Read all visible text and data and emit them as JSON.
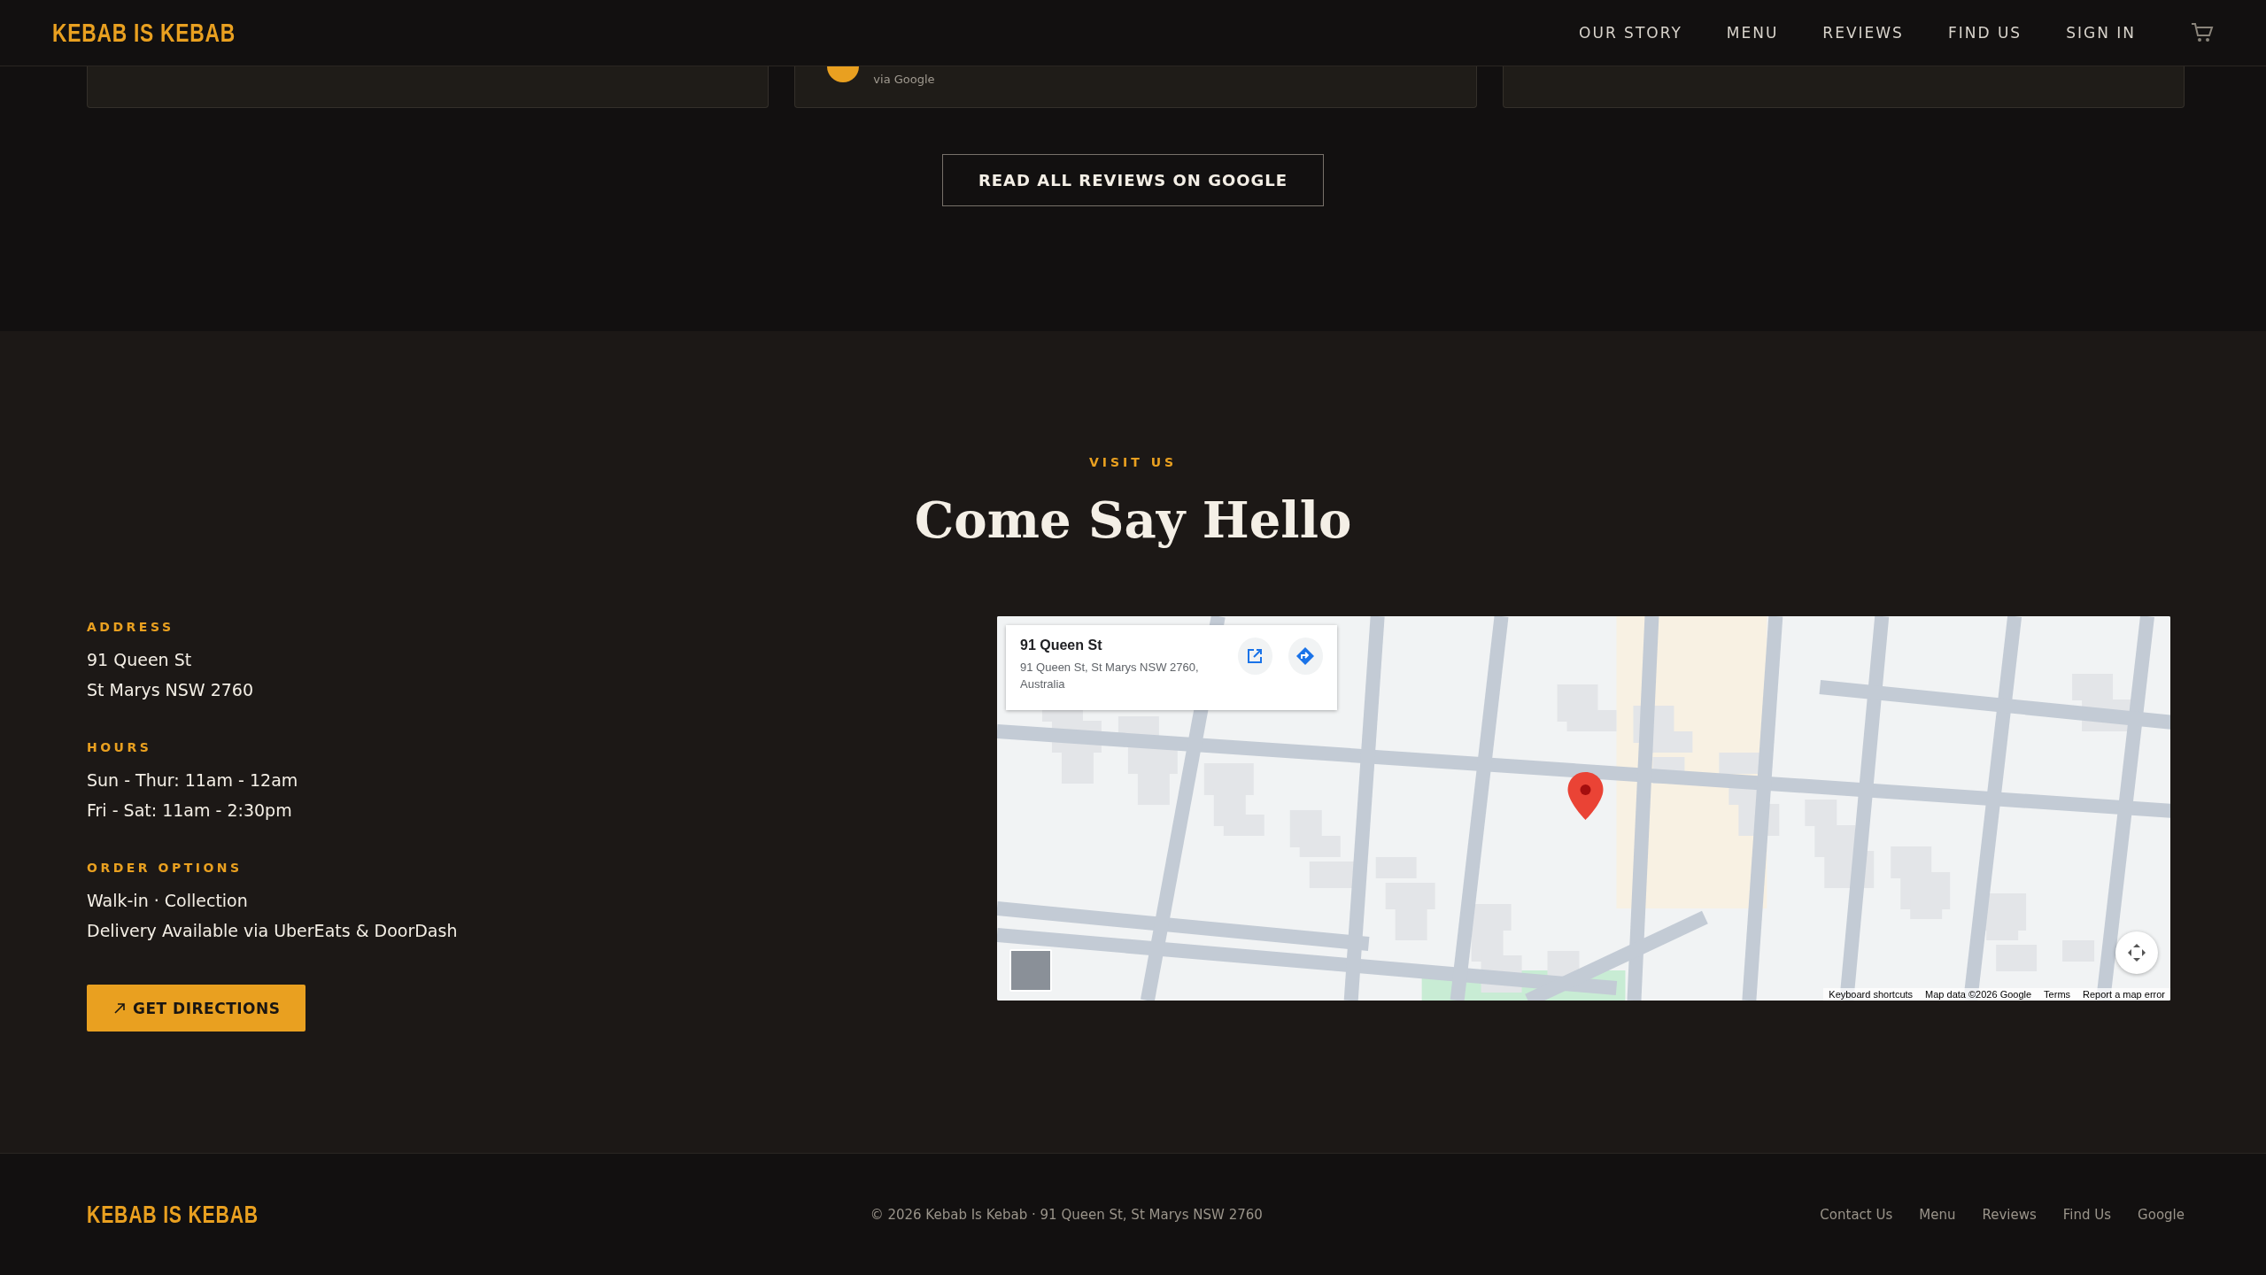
{
  "nav": {
    "logo": "KEBAB IS KEBAB",
    "links": [
      "OUR STORY",
      "MENU",
      "REVIEWS",
      "FIND US",
      "SIGN IN"
    ]
  },
  "reviews": {
    "cards": [
      {
        "kind": "blank"
      },
      {
        "kind": "reviewer",
        "source": "via Google"
      },
      {
        "kind": "blank"
      }
    ],
    "button": "READ ALL REVIEWS ON GOOGLE"
  },
  "visit": {
    "eyebrow": "VISIT US",
    "title": "Come Say Hello",
    "groups": [
      {
        "label": "ADDRESS",
        "lines": [
          "91 Queen St",
          "St Marys NSW 2760"
        ]
      },
      {
        "label": "HOURS",
        "lines": [
          "Sun - Thur: 11am - 12am",
          "Fri - Sat: 11am - 2:30pm"
        ]
      },
      {
        "label": "ORDER OPTIONS",
        "lines": [
          "Walk-in · Collection",
          "Delivery Available via UberEats & DoorDash"
        ]
      }
    ],
    "button": "GET DIRECTIONS",
    "map": {
      "card_title": "91 Queen St",
      "card_address": "91 Queen St, St Marys NSW 2760, Australia",
      "attribution": [
        "Keyboard shortcuts",
        "Map data ©2026 Google",
        "Terms",
        "Report a map error"
      ]
    }
  },
  "footer": {
    "logo": "KEBAB IS KEBAB",
    "copyright": "© 2026 Kebab Is Kebab · 91 Queen St, St Marys NSW 2760",
    "links": [
      "Contact Us",
      "Menu",
      "Reviews",
      "Find Us",
      "Google"
    ]
  }
}
